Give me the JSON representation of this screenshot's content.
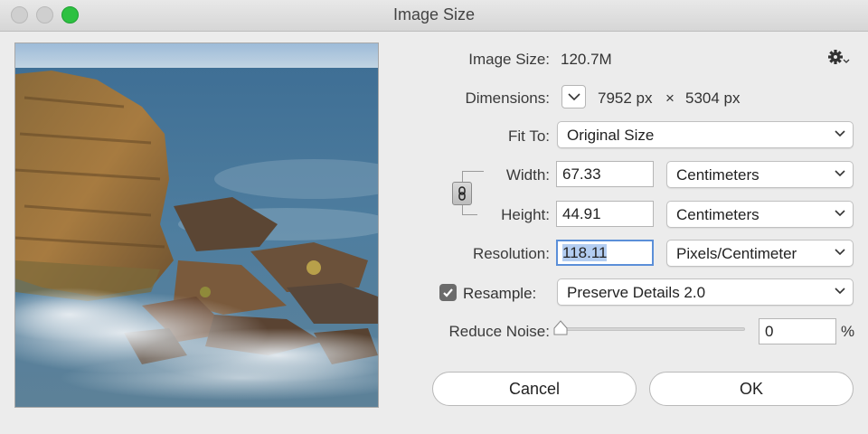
{
  "window": {
    "title": "Image Size"
  },
  "image_size": {
    "label": "Image Size:",
    "value": "120.7M"
  },
  "dimensions": {
    "label": "Dimensions:",
    "width_px": "7952 px",
    "times": "×",
    "height_px": "5304 px"
  },
  "fit_to": {
    "label": "Fit To:",
    "value": "Original Size"
  },
  "width": {
    "label": "Width:",
    "value": "67.33",
    "unit": "Centimeters"
  },
  "height": {
    "label": "Height:",
    "value": "44.91",
    "unit": "Centimeters"
  },
  "resolution": {
    "label": "Resolution:",
    "value": "118.11",
    "unit": "Pixels/Centimeter"
  },
  "resample": {
    "label": "Resample:",
    "checked": true,
    "method": "Preserve Details 2.0"
  },
  "reduce_noise": {
    "label": "Reduce Noise:",
    "value": "0",
    "unit": "%",
    "level": 0
  },
  "buttons": {
    "cancel": "Cancel",
    "ok": "OK"
  },
  "icons": {
    "settings": "gear-icon",
    "link": "chain-link-icon",
    "chevron": "chevron-down-icon"
  },
  "colors": {
    "checkbox": "#6b6b6b",
    "selection": "#b3cdf1",
    "focus_ring": "#5b8fd8",
    "zoom_light": "#2dc141"
  }
}
